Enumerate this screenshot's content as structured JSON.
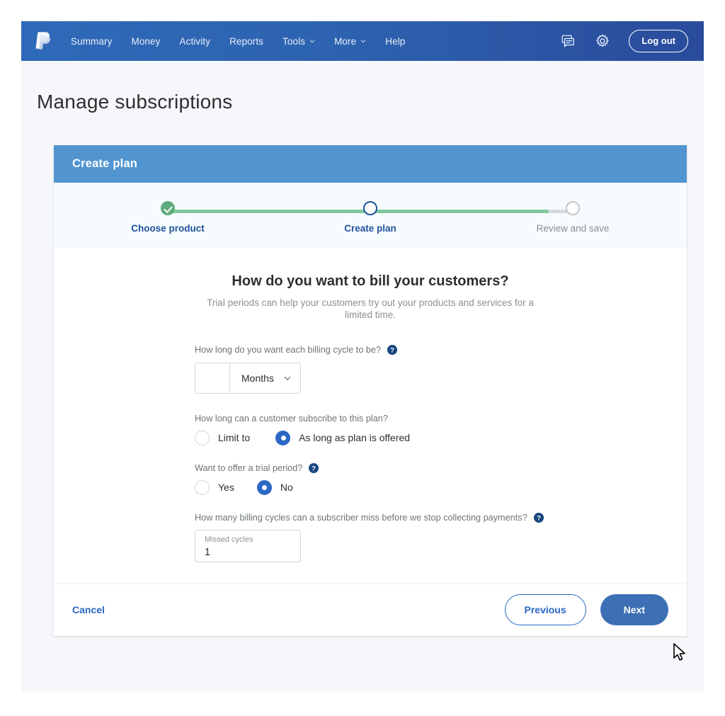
{
  "nav": {
    "logo_icon": "paypal-logo-icon",
    "links": [
      {
        "label": "Summary",
        "has_caret": false
      },
      {
        "label": "Money",
        "has_caret": false
      },
      {
        "label": "Activity",
        "has_caret": false
      },
      {
        "label": "Reports",
        "has_caret": false
      },
      {
        "label": "Tools",
        "has_caret": true
      },
      {
        "label": "More",
        "has_caret": true
      },
      {
        "label": "Help",
        "has_caret": false
      }
    ],
    "message_icon": "message-icon",
    "settings_icon": "gear-icon",
    "logout_label": "Log out"
  },
  "page": {
    "title": "Manage subscriptions"
  },
  "card": {
    "header_title": "Create plan"
  },
  "stepper": {
    "steps": [
      {
        "label": "Choose product",
        "state": "done"
      },
      {
        "label": "Create plan",
        "state": "current"
      },
      {
        "label": "Review and save",
        "state": "upcoming"
      }
    ],
    "fill_percent": 94
  },
  "form": {
    "heading": "How do you want to bill your customers?",
    "subheading": "Trial periods can help your customers try out your products and services for a limited time.",
    "billing_cycle": {
      "label": "How long do you want each billing cycle to be?",
      "help_icon": "help-circle-icon",
      "count_value": "",
      "count_placeholder": "",
      "unit_value": "Months",
      "unit_caret_icon": "chevron-down-icon"
    },
    "subscribe_length": {
      "label": "How long can a customer subscribe to this plan?",
      "options": [
        {
          "label": "Limit to",
          "selected": false
        },
        {
          "label": "As long as plan is offered",
          "selected": true
        }
      ]
    },
    "trial_period": {
      "label": "Want to offer a trial period?",
      "help_icon": "help-circle-icon",
      "options": [
        {
          "label": "Yes",
          "selected": false
        },
        {
          "label": "No",
          "selected": true
        }
      ]
    },
    "missed_cycles": {
      "label": "How many billing cycles can a subscriber miss before we stop collecting payments?",
      "help_icon": "help-circle-icon",
      "field_label": "Missed cycles",
      "field_value": "1"
    }
  },
  "footer": {
    "cancel_label": "Cancel",
    "previous_label": "Previous",
    "next_label": "Next"
  },
  "colors": {
    "nav_blue": "#2d63b0",
    "card_header_blue": "#5294d0",
    "accent_blue": "#2a68c4",
    "primary_button_blue": "#3d6fb5",
    "step_done_green": "#62ab7c",
    "step_track_green": "#7ec79a",
    "page_background": "#f5f7fa",
    "text_dark": "#2c2e2f",
    "text_muted": "#8b9096"
  }
}
